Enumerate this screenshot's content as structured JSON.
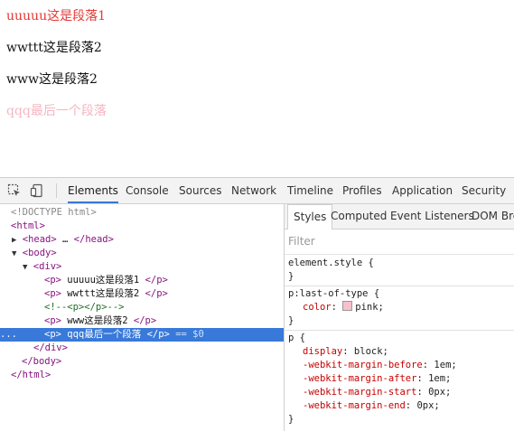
{
  "page": {
    "paragraphs": [
      {
        "text": "uuuuu这是段落1",
        "color": "#e53935"
      },
      {
        "text": "wwttt这是段落2",
        "color": "#111111"
      },
      {
        "text": "www这是段落2",
        "color": "#111111"
      },
      {
        "text": "qqq最后一个段落",
        "color": "#f4b7c2"
      }
    ]
  },
  "devtools": {
    "tool_icons": [
      "inspect-element-icon",
      "device-mode-icon"
    ],
    "tabs": [
      "Elements",
      "Console",
      "Sources",
      "Network",
      "Timeline",
      "Profiles",
      "Application",
      "Security"
    ],
    "active_tab": "Elements",
    "accent_color": "#3879d9",
    "dom": {
      "doctype": "<!DOCTYPE html>",
      "html_open": "<html>",
      "head": "<head>",
      "ellipsis": "…",
      "head_close": "</head>",
      "body_open": "<body>",
      "div_open": "<div>",
      "p_open": "<p>",
      "p_close": "</p>",
      "p1_text": " uuuuu这是段落1 ",
      "p2_text": " wwttt这是段落2 ",
      "comment": "<!--<p></p>-->",
      "p3_text": " www这是段落2 ",
      "p4_text": " qqq最后一个段落 ",
      "selected_dots": "...",
      "selected_marker": "== $0",
      "div_close": "</div>",
      "body_close": "</body>",
      "html_close": "</html>"
    },
    "styles": {
      "tabs": [
        "Styles",
        "Computed",
        "Event Listeners",
        "DOM Bre"
      ],
      "active_tab": "Styles",
      "filter_placeholder": "Filter",
      "element_style_selector": "element.style {",
      "close_brace": "}",
      "rule2_selector": "p:last-of-type {",
      "rule2_prop": "color",
      "rule2_value": "pink;",
      "rule2_swatch": "#f9c0cb",
      "rule3_selector": "p {",
      "rule3_decls": [
        {
          "prop": "display",
          "value": "block;"
        },
        {
          "prop": "-webkit-margin-before",
          "value": "1em;"
        },
        {
          "prop": "-webkit-margin-after",
          "value": "1em;"
        },
        {
          "prop": "-webkit-margin-start",
          "value": "0px;"
        },
        {
          "prop": "-webkit-margin-end",
          "value": "0px;"
        }
      ]
    }
  }
}
